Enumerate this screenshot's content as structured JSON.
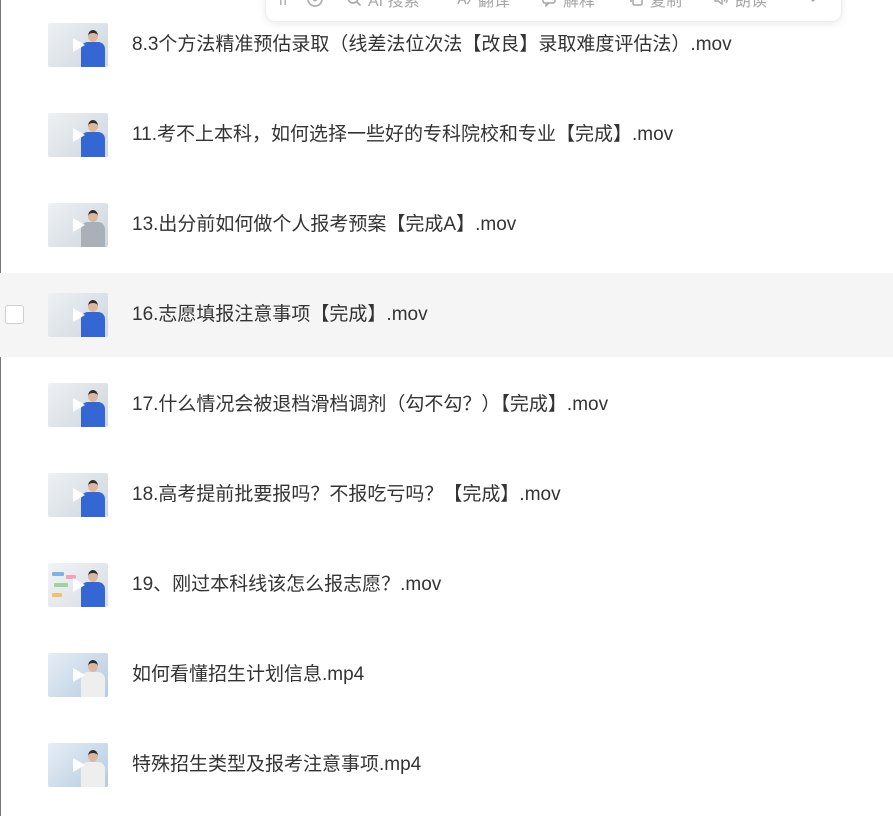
{
  "toolbar": {
    "items": [
      {
        "label": "AI 搜索",
        "icon": "search-icon"
      },
      {
        "label": "翻译",
        "icon": "translate-icon"
      },
      {
        "label": "解释",
        "icon": "explain-icon"
      },
      {
        "label": "复制",
        "icon": "copy-icon"
      },
      {
        "label": "朗读",
        "icon": "read-aloud-icon"
      }
    ],
    "icon_color": "#a6a6a6"
  },
  "files": [
    {
      "name": "8.3个方法精准预估录取（线差法位次法【改良】录取难度评估法）.mov",
      "hovered": false,
      "thumb": {
        "bg": "#eef1f3",
        "bg2": "#cdd6de",
        "shirt": "#3567d4"
      }
    },
    {
      "name": "11.考不上本科，如何选择一些好的专科院校和专业【完成】.mov",
      "hovered": false,
      "thumb": {
        "bg": "#eef1f3",
        "bg2": "#cdd6de",
        "shirt": "#3567d4"
      }
    },
    {
      "name": "13.出分前如何做个人报考预案【完成A】.mov",
      "hovered": false,
      "thumb": {
        "bg": "#eef1f3",
        "bg2": "#cdd6de",
        "shirt": "#a9b0b8"
      }
    },
    {
      "name": "16.志愿填报注意事项【完成】.mov",
      "hovered": true,
      "checked": false,
      "thumb": {
        "bg": "#eef1f3",
        "bg2": "#cdd6de",
        "shirt": "#3567d4"
      }
    },
    {
      "name": "17.什么情况会被退档滑档调剂（勾不勾？）【完成】.mov",
      "hovered": false,
      "thumb": {
        "bg": "#eef1f3",
        "bg2": "#cdd6de",
        "shirt": "#3567d4"
      }
    },
    {
      "name": "18.高考提前批要报吗？不报吃亏吗？【完成】.mov",
      "hovered": false,
      "thumb": {
        "bg": "#eef1f3",
        "bg2": "#cdd6de",
        "shirt": "#3567d4"
      }
    },
    {
      "name": "19、刚过本科线该怎么报志愿？.mov",
      "hovered": false,
      "slides": true,
      "thumb": {
        "bg": "#f2f4f6",
        "bg2": "#d6dde4",
        "shirt": "#3567d4"
      }
    },
    {
      "name": "如何看懂招生计划信息.mp4",
      "hovered": false,
      "thumb": {
        "bg": "#e6eef6",
        "bg2": "#b7cbe0",
        "shirt": "#eeeeee"
      }
    },
    {
      "name": "特殊招生类型及报考注意事项.mp4",
      "hovered": false,
      "thumb": {
        "bg": "#e6eef6",
        "bg2": "#b7cbe0",
        "shirt": "#eeeeee"
      }
    }
  ]
}
